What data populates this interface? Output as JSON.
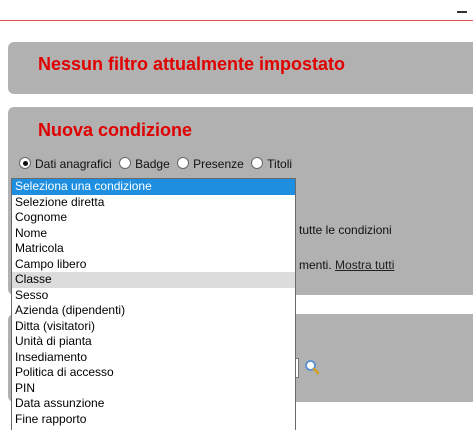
{
  "filter_panel": {
    "title": "Nessun filtro attualmente impostato"
  },
  "condition_panel": {
    "title": "Nuova condizione",
    "radios": [
      {
        "label": "Dati anagrafici",
        "checked": true
      },
      {
        "label": "Badge",
        "checked": false
      },
      {
        "label": "Presenze",
        "checked": false
      },
      {
        "label": "Titoli",
        "checked": false
      }
    ],
    "fragment_1": "tutte le condizioni",
    "fragment_2": "menti.",
    "show_all_link": "Mostra tutti"
  },
  "dropdown": {
    "options": [
      "Seleziona una condizione",
      "Selezione diretta",
      "Cognome",
      "Nome",
      "Matricola",
      "Campo libero",
      "Classe",
      "Sesso",
      "Azienda (dipendenti)",
      "Ditta (visitatori)",
      "Unità di pianta",
      "Insediamento",
      "Politica di accesso",
      "PIN",
      "Data assunzione",
      "Fine rapporto"
    ],
    "selected_index": 0,
    "hover_index": 6
  },
  "icons": {
    "search": "search-icon"
  },
  "colors": {
    "accent_red": "#e00000",
    "panel_gray": "#b1b1b1",
    "selection_blue": "#1e8fe0"
  }
}
